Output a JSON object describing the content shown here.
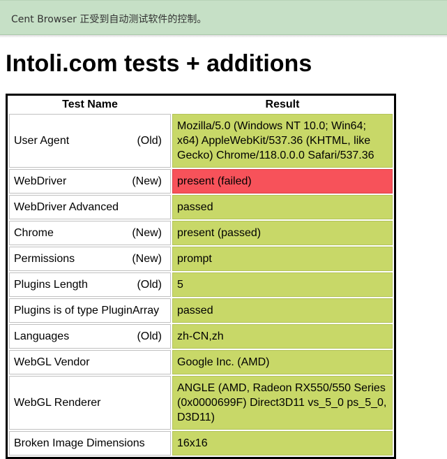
{
  "infobar": {
    "text": "Cent Browser 正受到自动测试软件的控制。"
  },
  "page": {
    "title": "Intoli.com tests + additions"
  },
  "table": {
    "headers": {
      "name": "Test Name",
      "result": "Result"
    },
    "rows": [
      {
        "name": "User Agent",
        "tag": "(Old)",
        "result": "Mozilla/5.0 (Windows NT 10.0; Win64; x64) AppleWebKit/537.36 (KHTML, like Gecko) Chrome/118.0.0.0 Safari/537.36",
        "status": "passed"
      },
      {
        "name": "WebDriver",
        "tag": "(New)",
        "result": "present (failed)",
        "status": "failed"
      },
      {
        "name": "WebDriver Advanced",
        "tag": "",
        "result": "passed",
        "status": "passed"
      },
      {
        "name": "Chrome",
        "tag": "(New)",
        "result": "present (passed)",
        "status": "passed"
      },
      {
        "name": "Permissions",
        "tag": "(New)",
        "result": "prompt",
        "status": "passed"
      },
      {
        "name": "Plugins Length",
        "tag": "(Old)",
        "result": "5",
        "status": "passed"
      },
      {
        "name": "Plugins is of type PluginArray",
        "tag": "",
        "result": "passed",
        "status": "passed"
      },
      {
        "name": "Languages",
        "tag": "(Old)",
        "result": "zh-CN,zh",
        "status": "passed"
      },
      {
        "name": "WebGL Vendor",
        "tag": "",
        "result": "Google Inc. (AMD)",
        "status": "passed"
      },
      {
        "name": "WebGL Renderer",
        "tag": "",
        "result": "ANGLE (AMD, Radeon RX550/550 Series (0x0000699F) Direct3D11 vs_5_0 ps_5_0, D3D11)",
        "status": "passed"
      },
      {
        "name": "Broken Image Dimensions",
        "tag": "",
        "result": "16x16",
        "status": "passed"
      }
    ]
  },
  "colors": {
    "passed": "#c8d868",
    "failed": "#f7525a",
    "infobar": "#c6e0c6"
  }
}
